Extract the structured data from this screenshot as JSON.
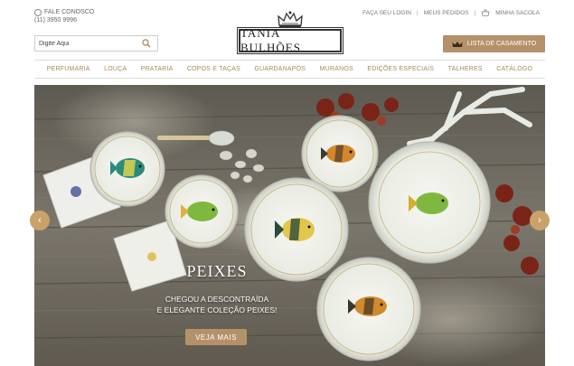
{
  "header": {
    "contact_label": "FALE CONOSCO",
    "contact_phone": "(11) 3950 9996",
    "brand": "TANIA BULHÕES",
    "links": {
      "login": "FAÇA SEU LOGIN",
      "orders": "MEUS PEDIDOS",
      "bag": "MINHA SACOLA"
    },
    "search_placeholder": "Digite Aqui",
    "wedding_button": "LISTA DE CASAMENTO"
  },
  "nav": {
    "items": [
      "PERFUMARIA",
      "LOUÇA",
      "PRATARIA",
      "COPOS E TAÇAS",
      "GUARDANAPOS",
      "MURANOS",
      "EDIÇÕES ESPECIAIS",
      "TALHERES",
      "CATÁLOGO"
    ]
  },
  "hero": {
    "title": "PEIXES",
    "line1": "CHEGOU A DESCONTRAÍDA",
    "line2": "E ELEGANTE COLEÇÃO PEIXES!",
    "cta": "VEJA MAIS",
    "prev": "‹",
    "next": "›"
  },
  "colors": {
    "accent": "#b5916a",
    "nav_text": "#a8875e",
    "wood": "#6f6a60"
  }
}
